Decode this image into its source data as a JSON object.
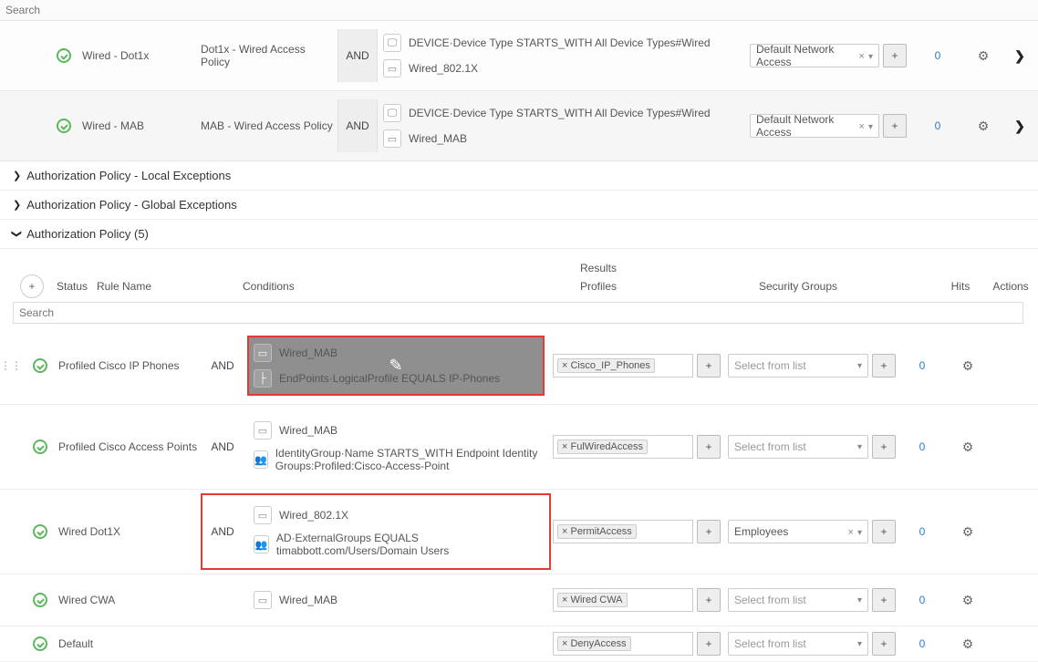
{
  "topSearchPlaceholder": "Search",
  "topPolicies": [
    {
      "name": "Wired - Dot1x",
      "desc": "Dot1x - Wired Access Policy",
      "logic": "AND",
      "conds": [
        {
          "icon": "monitor",
          "text": "DEVICE·Device Type STARTS_WITH All Device Types#Wired"
        },
        {
          "icon": "box",
          "text": "Wired_802.1X"
        }
      ],
      "netAccess": "Default Network Access",
      "hits": "0"
    },
    {
      "name": "Wired - MAB",
      "desc": "MAB - Wired Access Policy",
      "logic": "AND",
      "conds": [
        {
          "icon": "monitor",
          "text": "DEVICE·Device Type STARTS_WITH All Device Types#Wired"
        },
        {
          "icon": "box",
          "text": "Wired_MAB"
        }
      ],
      "netAccess": "Default Network Access",
      "hits": "0"
    }
  ],
  "sections": {
    "localEx": "Authorization Policy - Local Exceptions",
    "globalEx": "Authorization Policy - Global Exceptions",
    "authPolicy": "Authorization Policy (5)"
  },
  "tableHead": {
    "status": "Status",
    "ruleName": "Rule Name",
    "conditions": "Conditions",
    "results": "Results",
    "profiles": "Profiles",
    "securityGroups": "Security Groups",
    "hits": "Hits",
    "actions": "Actions"
  },
  "authSearchPlaceholder": "Search",
  "selectFromList": "Select from list",
  "authRows": [
    {
      "name": "Profiled Cisco IP Phones",
      "logic": "AND",
      "drag": true,
      "highlight": "dark-red",
      "conds": [
        {
          "icon": "box",
          "text": "Wired_MAB"
        },
        {
          "icon": "tree",
          "text": "EndPoints·LogicalProfile EQUALS IP-Phones"
        }
      ],
      "profileTag": "× Cisco_IP_Phones",
      "secGroup": {
        "type": "placeholder"
      },
      "hits": "0"
    },
    {
      "name": "Profiled Cisco Access Points",
      "logic": "AND",
      "conds": [
        {
          "icon": "box",
          "text": "Wired_MAB"
        },
        {
          "icon": "group",
          "text": "IdentityGroup·Name STARTS_WITH Endpoint Identity Groups:Profiled:Cisco-Access-Point"
        }
      ],
      "profileTag": "× FulWiredAccess",
      "secGroup": {
        "type": "placeholder"
      },
      "hits": "0"
    },
    {
      "name": "Wired Dot1X",
      "logic": "AND",
      "highlight": "red",
      "conds": [
        {
          "icon": "box",
          "text": "Wired_802.1X"
        },
        {
          "icon": "group",
          "text": "AD·ExternalGroups EQUALS timabbott.com/Users/Domain Users"
        }
      ],
      "profileTag": "× PermitAccess",
      "secGroup": {
        "type": "value",
        "value": "Employees"
      },
      "hits": "0"
    },
    {
      "name": "Wired CWA",
      "logic": "",
      "conds": [
        {
          "icon": "box",
          "text": "Wired_MAB"
        }
      ],
      "profileTag": "× Wired CWA",
      "secGroup": {
        "type": "placeholder"
      },
      "hits": "0"
    },
    {
      "name": "Default",
      "logic": "",
      "conds": [],
      "profileTag": "× DenyAccess",
      "secGroup": {
        "type": "placeholder"
      },
      "hits": "0"
    }
  ]
}
